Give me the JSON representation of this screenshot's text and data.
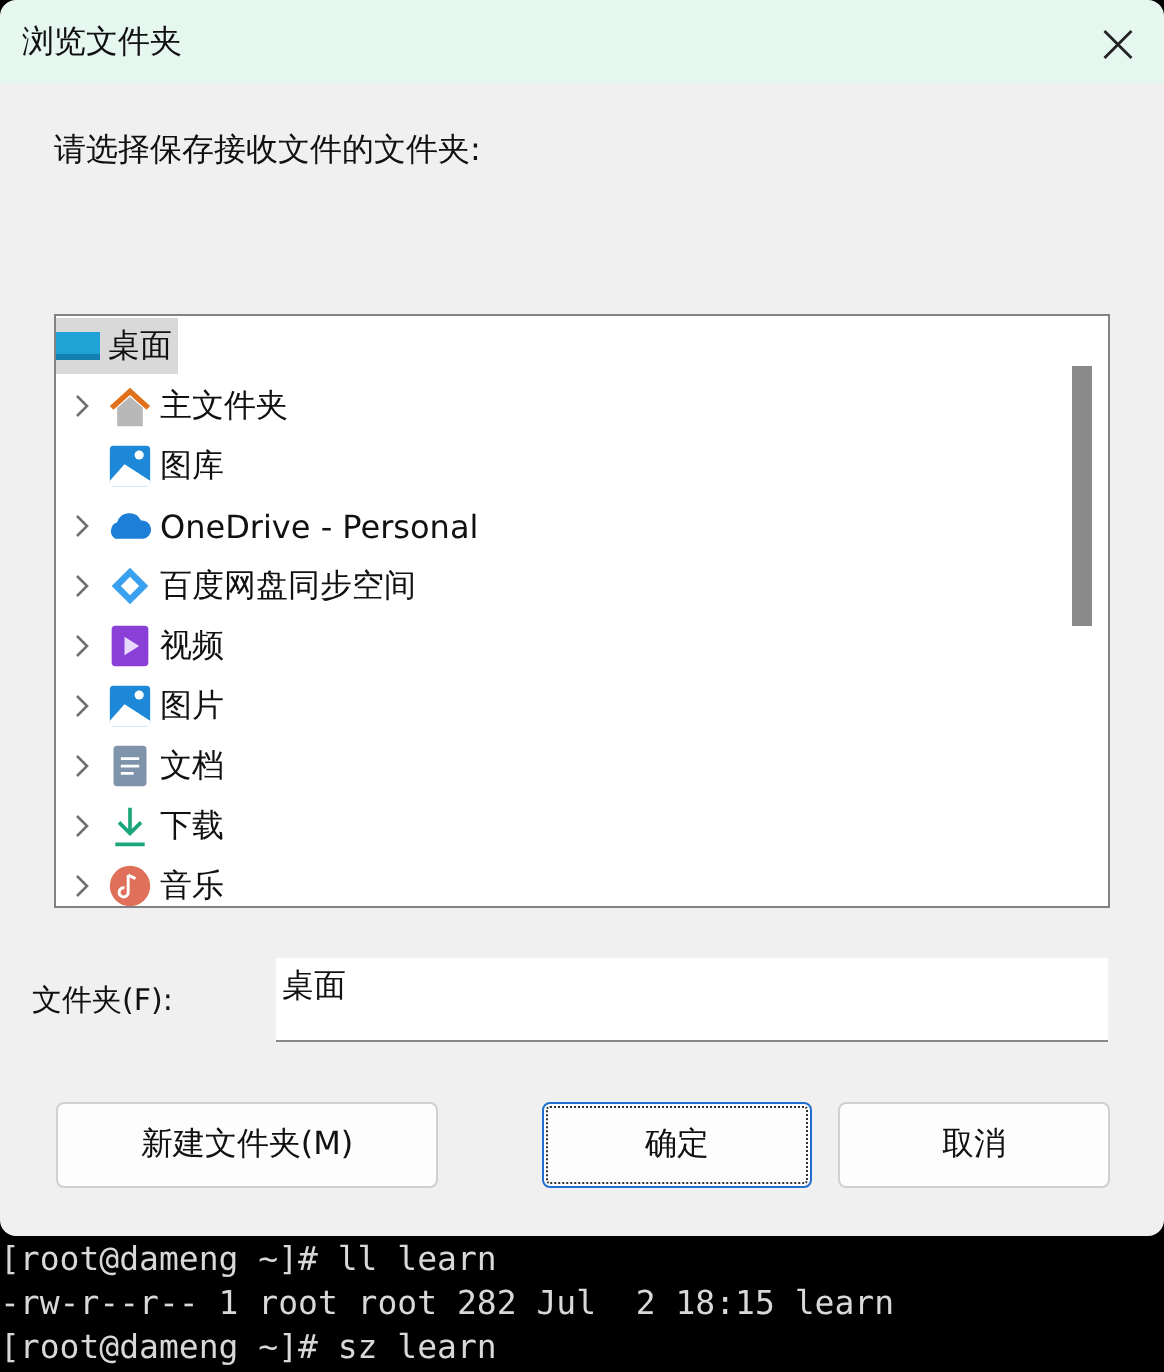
{
  "window": {
    "title": "浏览文件夹",
    "close": "×"
  },
  "prompt": "请选择保存接收文件的文件夹:",
  "tree": {
    "label": "桌面",
    "kind": "desktop",
    "selected": true,
    "children": [
      {
        "label": "主文件夹",
        "kind": "home",
        "has_children": true,
        "selected": false
      },
      {
        "label": "图库",
        "kind": "gallery",
        "has_children": false,
        "selected": false
      },
      {
        "label": "OneDrive - Personal",
        "kind": "cloud",
        "has_children": true,
        "selected": false
      },
      {
        "label": "百度网盘同步空间",
        "kind": "sync",
        "has_children": true,
        "selected": false
      },
      {
        "label": "视频",
        "kind": "video",
        "has_children": true,
        "selected": false
      },
      {
        "label": "图片",
        "kind": "pictures",
        "has_children": true,
        "selected": false
      },
      {
        "label": "文档",
        "kind": "documents",
        "has_children": true,
        "selected": false
      },
      {
        "label": "下载",
        "kind": "downloads",
        "has_children": true,
        "selected": false
      },
      {
        "label": "音乐",
        "kind": "music",
        "has_children": true,
        "selected": false
      }
    ]
  },
  "folder_field": {
    "label": "文件夹(F):",
    "value": "桌面"
  },
  "buttons": [
    {
      "label": "新建文件夹(M)",
      "focused": false
    },
    {
      "label": "确定",
      "focused": true
    },
    {
      "label": "取消",
      "focused": false
    }
  ],
  "terminal": [
    "[root@dameng ~]# ll learn",
    "-rw-r--r-- 1 root root 282 Jul  2 18:15 learn",
    "[root@dameng ~]# sz learn"
  ]
}
